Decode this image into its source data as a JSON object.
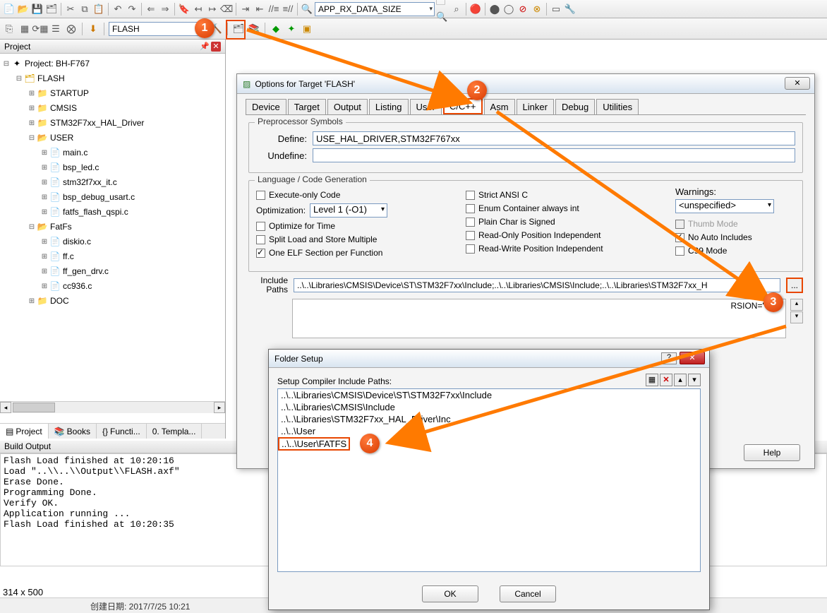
{
  "toolbar": {
    "search_combo": "APP_RX_DATA_SIZE",
    "target_combo": "FLASH"
  },
  "project_panel": {
    "title": "Project",
    "root": "Project: BH-F767",
    "target": "FLASH",
    "groups": [
      {
        "name": "STARTUP",
        "expandable": true,
        "open": false
      },
      {
        "name": "CMSIS",
        "expandable": true,
        "open": false
      },
      {
        "name": "STM32F7xx_HAL_Driver",
        "expandable": true,
        "open": false
      },
      {
        "name": "USER",
        "expandable": true,
        "open": true,
        "files": [
          "main.c",
          "bsp_led.c",
          "stm32f7xx_it.c",
          "bsp_debug_usart.c",
          "fatfs_flash_qspi.c"
        ]
      },
      {
        "name": "FatFs",
        "expandable": true,
        "open": true,
        "files": [
          "diskio.c",
          "ff.c",
          "ff_gen_drv.c",
          "cc936.c"
        ]
      },
      {
        "name": "DOC",
        "expandable": true,
        "open": false
      }
    ],
    "tabs": [
      "Project",
      "Books",
      "Functi...",
      "Templa..."
    ]
  },
  "build_output": {
    "title": "Build Output",
    "lines": "Flash Load finished at 10:20:16\nLoad \"..\\\\..\\\\Output\\\\FLASH.axf\"\nErase Done.\nProgramming Done.\nVerify OK.\nApplication running ...\nFlash Load finished at 10:20:35"
  },
  "status": {
    "dimensions": "314 x 500",
    "date_label": "创建日期: 2017/7/25 10:21"
  },
  "options_dialog": {
    "title": "Options for Target 'FLASH'",
    "tabs": [
      "Device",
      "Target",
      "Output",
      "Listing",
      "User",
      "C/C++",
      "Asm",
      "Linker",
      "Debug",
      "Utilities"
    ],
    "active_tab": "C/C++",
    "preproc": {
      "legend": "Preprocessor Symbols",
      "define_label": "Define:",
      "define_value": "USE_HAL_DRIVER,STM32F767xx",
      "undefine_label": "Undefine:",
      "undefine_value": ""
    },
    "codegen": {
      "legend": "Language / Code Generation",
      "exec_only": "Execute-only Code",
      "optimization_label": "Optimization:",
      "optimization_value": "Level 1 (-O1)",
      "opt_time": "Optimize for Time",
      "split_load": "Split Load and Store Multiple",
      "one_elf": "One ELF Section per Function",
      "strict_ansi": "Strict ANSI C",
      "enum_container": "Enum Container always int",
      "plain_char": "Plain Char is Signed",
      "ro_pi": "Read-Only Position Independent",
      "rw_pi": "Read-Write Position Independent",
      "warnings_label": "Warnings:",
      "warnings_value": "<unspecified>",
      "thumb": "Thumb Mode",
      "no_auto": "No Auto Includes",
      "c99": "C99 Mode"
    },
    "include": {
      "label": "Include\nPaths",
      "value": "..\\..\\Libraries\\CMSIS\\Device\\ST\\STM32F7xx\\Include;..\\..\\Libraries\\CMSIS\\Include;..\\..\\Libraries\\STM32F7xx_H"
    },
    "compiler_string": "RSION=\"521\"",
    "help": "Help"
  },
  "folder_setup": {
    "title": "Folder Setup",
    "label": "Setup Compiler Include Paths:",
    "items": [
      "..\\..\\Libraries\\CMSIS\\Device\\ST\\STM32F7xx\\Include",
      "..\\..\\Libraries\\CMSIS\\Include",
      "..\\..\\Libraries\\STM32F7xx_HAL_Driver\\Inc",
      "..\\..\\User",
      "..\\..\\User\\FATFS"
    ],
    "ok": "OK",
    "cancel": "Cancel"
  },
  "annotations": {
    "b1": "1",
    "b2": "2",
    "b3": "3",
    "b4": "4"
  }
}
